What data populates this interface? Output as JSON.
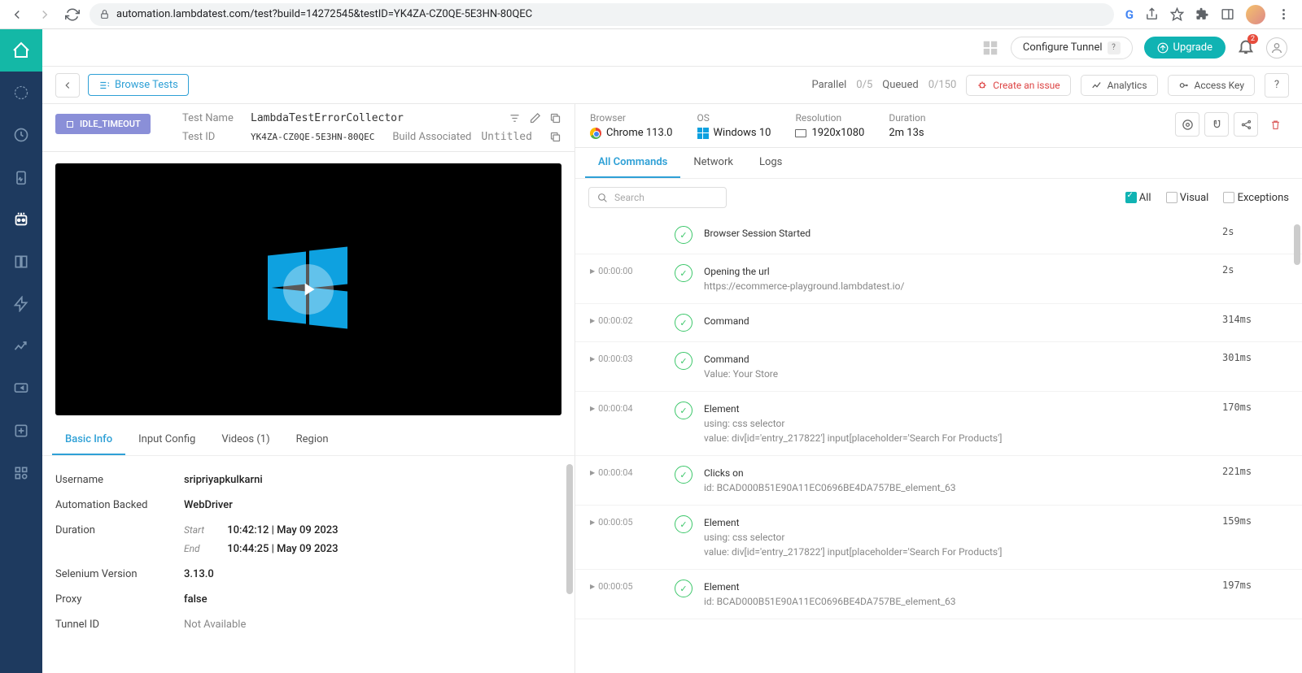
{
  "browser": {
    "url": "automation.lambdatest.com/test?build=14272545&testID=YK4ZA-CZ0QE-5E3HN-80QEC"
  },
  "topHeader": {
    "configureTunnel": "Configure Tunnel",
    "upgrade": "Upgrade",
    "bellCount": "2"
  },
  "subHeader": {
    "browseTests": "Browse Tests",
    "parallelLabel": "Parallel",
    "parallelValue": "0/5",
    "queuedLabel": "Queued",
    "queuedValue": "0/150",
    "createIssue": "Create an issue",
    "analytics": "Analytics",
    "accessKey": "Access Key"
  },
  "testMeta": {
    "statusChip": "IDLE_TIMEOUT",
    "testNameLabel": "Test Name",
    "testName": "LambdaTestErrorCollector",
    "testIdLabel": "Test ID",
    "testId": "YK4ZA-CZ0QE-5E3HN-80QEC",
    "buildAssocLabel": "Build Associated",
    "buildAssoc": "Untitled"
  },
  "env": {
    "browserLabel": "Browser",
    "browserValue": "Chrome 113.0",
    "osLabel": "OS",
    "osValue": "Windows 10",
    "resolutionLabel": "Resolution",
    "resolutionValue": "1920x1080",
    "durationLabel": "Duration",
    "durationValue": "2m 13s"
  },
  "infoTabs": [
    "Basic Info",
    "Input Config",
    "Videos (1)",
    "Region"
  ],
  "basicInfo": {
    "usernameLabel": "Username",
    "username": "sripriyapkulkarni",
    "automationBackedLabel": "Automation Backed",
    "automationBacked": "WebDriver",
    "durationLabel": "Duration",
    "startLabel": "Start",
    "start": "10:42:12 | May 09 2023",
    "endLabel": "End",
    "end": "10:44:25 | May 09 2023",
    "seleniumLabel": "Selenium Version",
    "selenium": "3.13.0",
    "proxyLabel": "Proxy",
    "proxy": "false",
    "tunnelLabel": "Tunnel ID",
    "tunnel": "Not Available"
  },
  "cmdTabs": [
    "All Commands",
    "Network",
    "Logs"
  ],
  "cmdFilters": {
    "all": "All",
    "visual": "Visual",
    "exceptions": "Exceptions"
  },
  "searchPlaceholder": "Search",
  "commands": [
    {
      "time": "",
      "title": "Browser Session Started",
      "sub": "",
      "dur": "2s"
    },
    {
      "time": "00:00:00",
      "title": "Opening the url",
      "sub": "https://ecommerce-playground.lambdatest.io/",
      "dur": "2s"
    },
    {
      "time": "00:00:02",
      "title": "Command",
      "sub": "",
      "dur": "314ms"
    },
    {
      "time": "00:00:03",
      "title": "Command",
      "sub": "Value: Your Store",
      "dur": "301ms"
    },
    {
      "time": "00:00:04",
      "title": "Element",
      "sub": "using: css selector\nvalue: div[id='entry_217822'] input[placeholder='Search For Products']",
      "dur": "170ms"
    },
    {
      "time": "00:00:04",
      "title": "Clicks on",
      "sub": "id: BCAD000B51E90A11EC0696BE4DA757BE_element_63",
      "dur": "221ms"
    },
    {
      "time": "00:00:05",
      "title": "Element",
      "sub": "using: css selector\nvalue: div[id='entry_217822'] input[placeholder='Search For Products']",
      "dur": "159ms"
    },
    {
      "time": "00:00:05",
      "title": "Element",
      "sub": "id: BCAD000B51E90A11EC0696BE4DA757BE_element_63",
      "dur": "197ms"
    }
  ]
}
